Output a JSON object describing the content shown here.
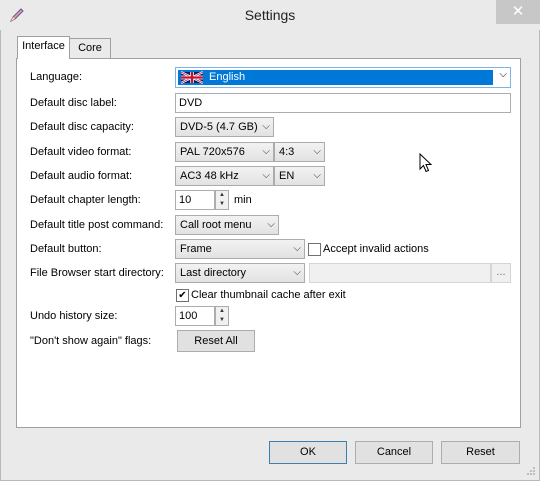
{
  "window": {
    "title": "Settings",
    "close_glyph": "✕"
  },
  "tabs": [
    {
      "label": "Interface"
    },
    {
      "label": "Core"
    }
  ],
  "form": {
    "language": {
      "label": "Language:",
      "value": "English",
      "flag_icon": "uk-flag-icon"
    },
    "disc_label": {
      "label": "Default disc label:",
      "value": "DVD"
    },
    "disc_capacity": {
      "label": "Default disc capacity:",
      "value": "DVD-5 (4.7 GB)"
    },
    "video_format": {
      "label": "Default video format:",
      "value": "PAL 720x576",
      "aspect": "4:3"
    },
    "audio_format": {
      "label": "Default audio format:",
      "value": "AC3 48 kHz",
      "lang": "EN"
    },
    "chapter_length": {
      "label": "Default chapter length:",
      "value": "10",
      "unit": "min"
    },
    "title_post_command": {
      "label": "Default title post command:",
      "value": "Call root menu"
    },
    "default_button": {
      "label": "Default button:",
      "value": "Frame",
      "accept_invalid_label": "Accept invalid actions",
      "accept_invalid_checked": false
    },
    "file_browser": {
      "label": "File Browser start directory:",
      "value": "Last directory",
      "path": "",
      "browse_label": "..."
    },
    "clear_thumb": {
      "label": "Clear thumbnail cache after exit",
      "checked": true
    },
    "undo_history": {
      "label": "Undo history size:",
      "value": "100"
    },
    "dont_show_again": {
      "label": "\"Don't show again\" flags:",
      "button": "Reset All"
    }
  },
  "buttons": {
    "ok": "OK",
    "cancel": "Cancel",
    "reset": "Reset"
  },
  "colors": {
    "selection": "#0078d7",
    "window_bg": "#eaeaea"
  }
}
